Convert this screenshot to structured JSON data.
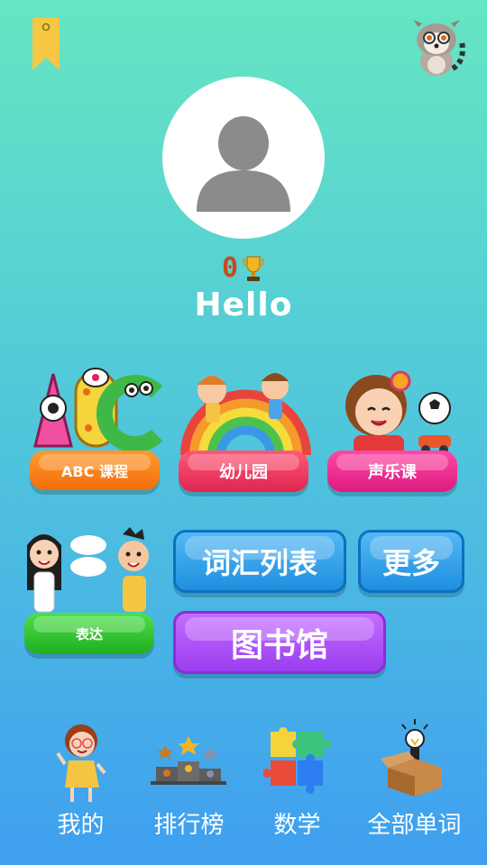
{
  "profile": {
    "score": "0",
    "greeting": "Hello"
  },
  "tiles": {
    "abc": "ABC 课程",
    "kindergarten": "幼儿园",
    "music": "声乐课",
    "express": "表达",
    "vocab": "词汇列表",
    "more": "更多",
    "library": "图书馆"
  },
  "nav": [
    {
      "label": "我的",
      "icon": "girl-icon"
    },
    {
      "label": "排行榜",
      "icon": "podium-icon"
    },
    {
      "label": "数学",
      "icon": "puzzle-icon"
    },
    {
      "label": "全部单词",
      "icon": "lightbulb-box-icon"
    }
  ],
  "colors": {
    "accent_score": "#c84a1e",
    "gradient_top": "#66e6c2",
    "gradient_bottom": "#3f9ff0"
  }
}
